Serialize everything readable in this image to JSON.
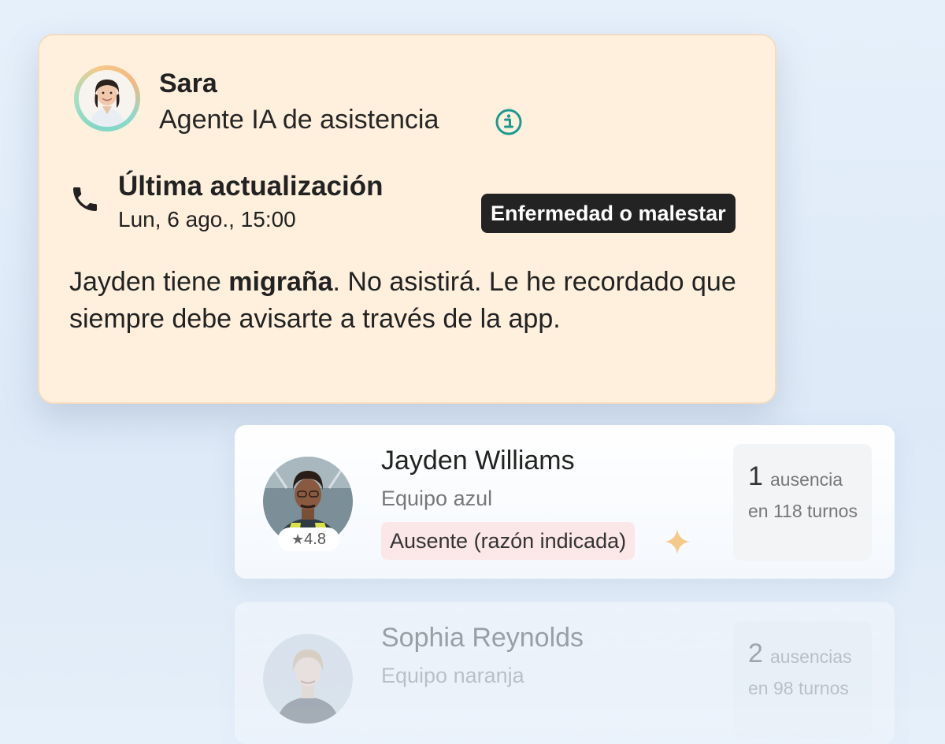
{
  "agent_card": {
    "name": "Sara",
    "role": "Agente IA de asistencia",
    "update_title": "Última actualización",
    "update_time": "Lun, 6 ago., 15:00",
    "reason_badge": "Enfermedad o malestar",
    "message_before": "Jayden tiene ",
    "message_bold": "migraña",
    "message_after": ". No asistirá. Le he recordado que siempre debe avisarte a través de la app.",
    "icons": [
      "info-icon",
      "phone-icon"
    ]
  },
  "workers": [
    {
      "name": "Jayden Williams",
      "team": "Equipo azul",
      "rating": "4.8",
      "status": "Ausente (razón indicada)",
      "absence_count": "1",
      "absence_word": "ausencia",
      "absence_sub": "en 118 turnos"
    },
    {
      "name": "Sophia Reynolds",
      "team": "Equipo naranja",
      "absence_count": "2",
      "absence_word": "ausencias",
      "absence_sub": "en 98 turnos"
    }
  ],
  "colors": {
    "agent_card_bg": "#fff0de",
    "reason_badge_bg": "#232323",
    "status_badge_bg": "#fbe6e8",
    "info_icon": "#1a9a8f",
    "sparkle": "#f5c98a"
  }
}
